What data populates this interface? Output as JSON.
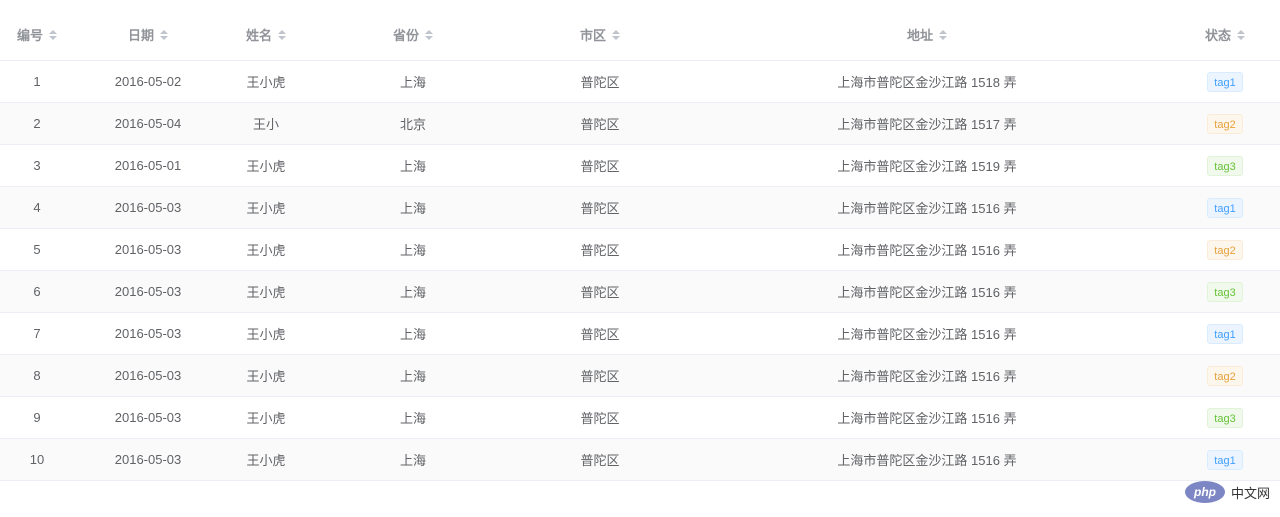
{
  "table": {
    "headers": [
      "编号",
      "日期",
      "姓名",
      "省份",
      "市区",
      "地址",
      "状态"
    ],
    "rows": [
      {
        "id": "1",
        "date": "2016-05-02",
        "name": "王小虎",
        "province": "上海",
        "city": "普陀区",
        "address": "上海市普陀区金沙江路 1518 弄",
        "tag": "tag1"
      },
      {
        "id": "2",
        "date": "2016-05-04",
        "name": "王小",
        "province": "北京",
        "city": "普陀区",
        "address": "上海市普陀区金沙江路 1517 弄",
        "tag": "tag2"
      },
      {
        "id": "3",
        "date": "2016-05-01",
        "name": "王小虎",
        "province": "上海",
        "city": "普陀区",
        "address": "上海市普陀区金沙江路 1519 弄",
        "tag": "tag3"
      },
      {
        "id": "4",
        "date": "2016-05-03",
        "name": "王小虎",
        "province": "上海",
        "city": "普陀区",
        "address": "上海市普陀区金沙江路 1516 弄",
        "tag": "tag1"
      },
      {
        "id": "5",
        "date": "2016-05-03",
        "name": "王小虎",
        "province": "上海",
        "city": "普陀区",
        "address": "上海市普陀区金沙江路 1516 弄",
        "tag": "tag2"
      },
      {
        "id": "6",
        "date": "2016-05-03",
        "name": "王小虎",
        "province": "上海",
        "city": "普陀区",
        "address": "上海市普陀区金沙江路 1516 弄",
        "tag": "tag3"
      },
      {
        "id": "7",
        "date": "2016-05-03",
        "name": "王小虎",
        "province": "上海",
        "city": "普陀区",
        "address": "上海市普陀区金沙江路 1516 弄",
        "tag": "tag1"
      },
      {
        "id": "8",
        "date": "2016-05-03",
        "name": "王小虎",
        "province": "上海",
        "city": "普陀区",
        "address": "上海市普陀区金沙江路 1516 弄",
        "tag": "tag2"
      },
      {
        "id": "9",
        "date": "2016-05-03",
        "name": "王小虎",
        "province": "上海",
        "city": "普陀区",
        "address": "上海市普陀区金沙江路 1516 弄",
        "tag": "tag3"
      },
      {
        "id": "10",
        "date": "2016-05-03",
        "name": "王小虎",
        "province": "上海",
        "city": "普陀区",
        "address": "上海市普陀区金沙江路 1516 弄",
        "tag": "tag1"
      }
    ]
  },
  "watermark": {
    "logo": "php",
    "text": "中文网"
  },
  "colors": {
    "tag1": "#409eff",
    "tag2": "#e6a23c",
    "tag3": "#67c23a",
    "header_text": "#909399",
    "stripe": "#fafafa"
  }
}
